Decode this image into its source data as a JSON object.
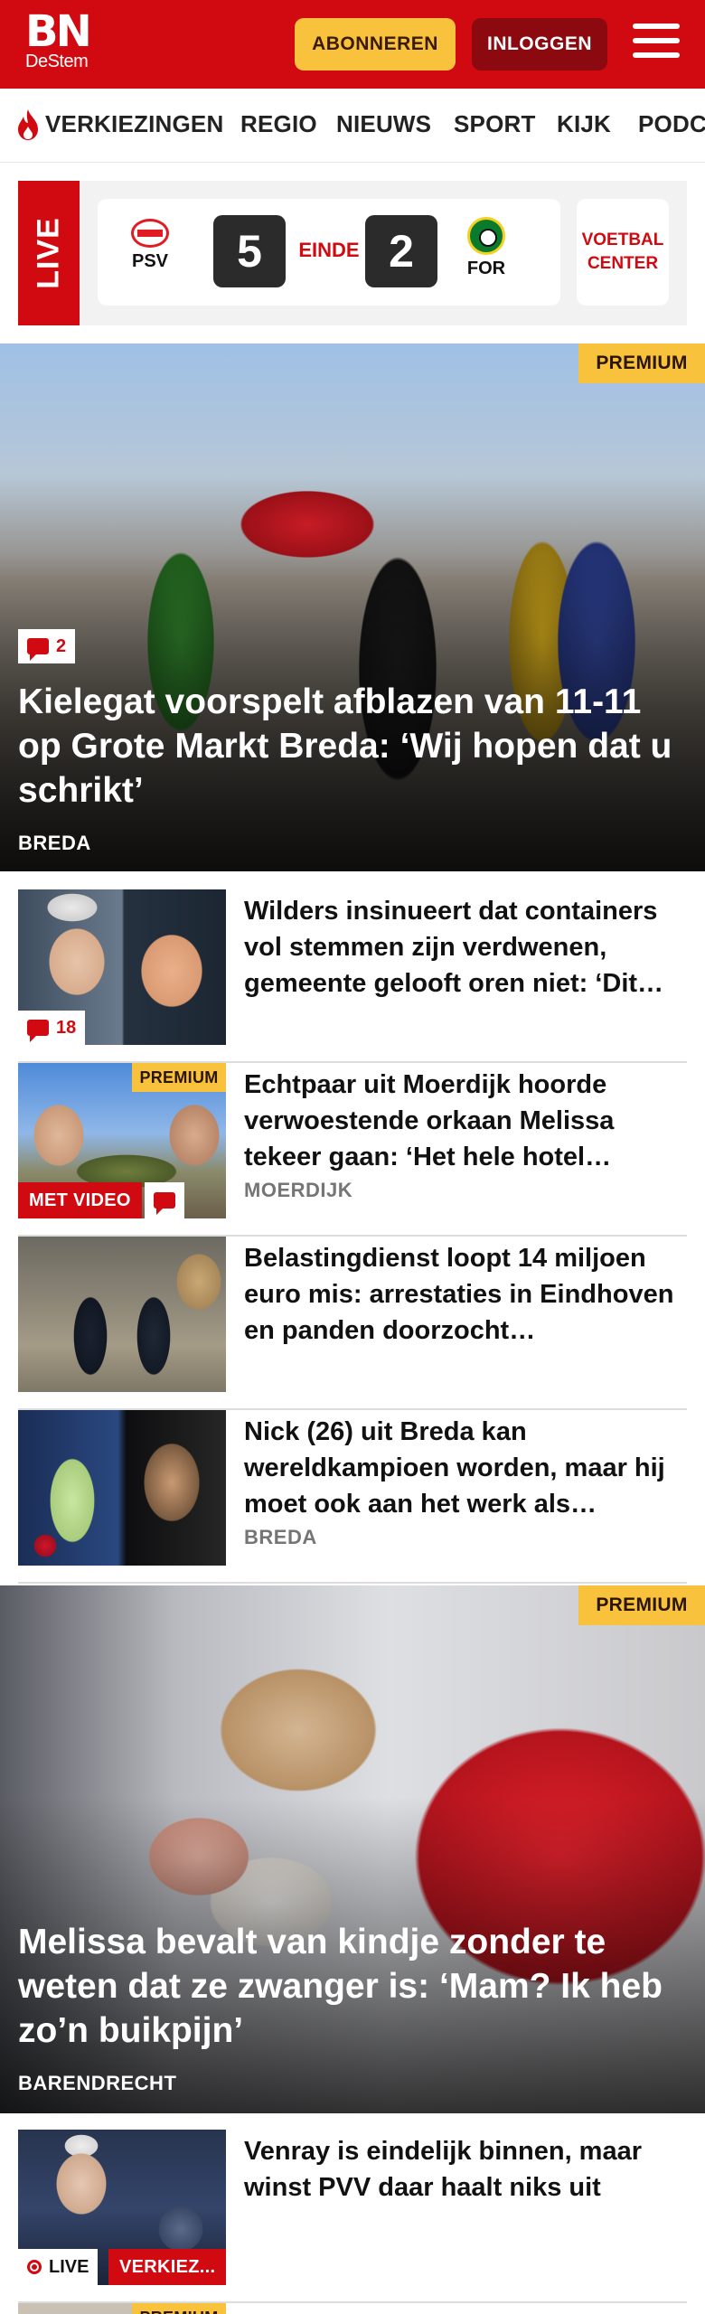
{
  "header": {
    "logo_main": "BN",
    "logo_sub": "DeStem",
    "subscribe_label": "ABONNEREN",
    "login_label": "INLOGGEN",
    "brand_color": "#d10a11"
  },
  "nav": {
    "items": [
      {
        "label": "VERKIEZINGEN",
        "icon": "flame-icon"
      },
      {
        "label": "REGIO"
      },
      {
        "label": "NIEUWS"
      },
      {
        "label": "SPORT"
      },
      {
        "label": "KIJK"
      },
      {
        "label": "PODC"
      }
    ]
  },
  "live_match": {
    "live_label": "LIVE",
    "home_team": "PSV",
    "home_score": "5",
    "status": "EINDE",
    "away_score": "2",
    "away_team": "FOR",
    "center_line1": "VOETBAL",
    "center_line2": "CENTER"
  },
  "hero1": {
    "premium_label": "PREMIUM",
    "comment_count": "2",
    "title": "Kielegat voorspelt afblazen van 11-11 op Grote Markt Breda: ‘Wij hopen dat u schrikt’",
    "category": "BREDA"
  },
  "list1": [
    {
      "title": "Wilders insinueert dat containers vol stemmen zijn verdwenen, gemeente gelooft oren niet: ‘Dit…",
      "comment_count": "18"
    },
    {
      "premium_label": "PREMIUM",
      "video_label": "MET VIDEO",
      "title": "Echtpaar uit Moerdijk hoorde verwoestende orkaan Melissa tekeer gaan: ‘Het hele hotel…",
      "category": "MOERDIJK"
    },
    {
      "title": "Belastingdienst loopt 14 miljoen euro mis: arrestaties in Eindhoven en panden doorzocht…"
    },
    {
      "title": "Nick (26) uit Breda kan wereldkampioen worden, maar hij moet ook aan het werk als…",
      "category": "BREDA"
    }
  ],
  "hero2": {
    "premium_label": "PREMIUM",
    "title": "Melissa bevalt van kindje zonder te weten dat ze zwanger is: ‘Mam? Ik heb zo’n buikpijn’",
    "category": "BARENDRECHT"
  },
  "list2": [
    {
      "title": "Venray is eindelijk binnen, maar winst PVV daar haalt niks uit",
      "live_label": "LIVE",
      "topic_label": "VERKIEZ..."
    },
    {
      "premium_label": "PREMIUM"
    }
  ]
}
